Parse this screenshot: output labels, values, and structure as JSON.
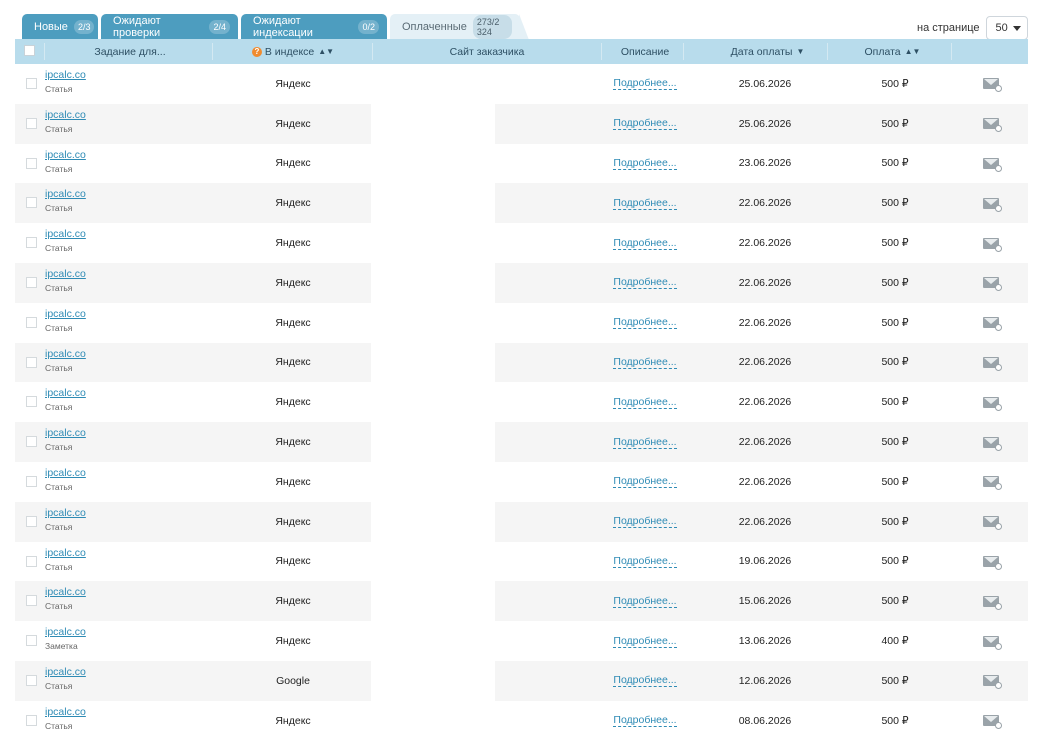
{
  "tabs": [
    {
      "label": "Новые",
      "badge": "2/3"
    },
    {
      "label": "Ожидают проверки",
      "badge": "2/4"
    },
    {
      "label": "Ожидают индексации",
      "badge": "0/2"
    },
    {
      "label": "Оплаченные",
      "badge": "273/2 324"
    }
  ],
  "per_page": {
    "label": "на странице",
    "value": "50"
  },
  "columns": {
    "task": "Задание для...",
    "index": "В индексе",
    "site": "Сайт заказчика",
    "description": "Описание",
    "date": "Дата оплаты",
    "payment": "Оплата"
  },
  "rows": [
    {
      "site": "ipcalc.co",
      "type": "Статья",
      "index": "Яндекс",
      "desc": "Подробнее...",
      "date": "25.06.2026",
      "pay": "500 ₽"
    },
    {
      "site": "ipcalc.co",
      "type": "Статья",
      "index": "Яндекс",
      "desc": "Подробнее...",
      "date": "25.06.2026",
      "pay": "500 ₽"
    },
    {
      "site": "ipcalc.co",
      "type": "Статья",
      "index": "Яндекс",
      "desc": "Подробнее...",
      "date": "23.06.2026",
      "pay": "500 ₽"
    },
    {
      "site": "ipcalc.co",
      "type": "Статья",
      "index": "Яндекс",
      "desc": "Подробнее...",
      "date": "22.06.2026",
      "pay": "500 ₽"
    },
    {
      "site": "ipcalc.co",
      "type": "Статья",
      "index": "Яндекс",
      "desc": "Подробнее...",
      "date": "22.06.2026",
      "pay": "500 ₽"
    },
    {
      "site": "ipcalc.co",
      "type": "Статья",
      "index": "Яндекс",
      "desc": "Подробнее...",
      "date": "22.06.2026",
      "pay": "500 ₽"
    },
    {
      "site": "ipcalc.co",
      "type": "Статья",
      "index": "Яндекс",
      "desc": "Подробнее...",
      "date": "22.06.2026",
      "pay": "500 ₽"
    },
    {
      "site": "ipcalc.co",
      "type": "Статья",
      "index": "Яндекс",
      "desc": "Подробнее...",
      "date": "22.06.2026",
      "pay": "500 ₽"
    },
    {
      "site": "ipcalc.co",
      "type": "Статья",
      "index": "Яндекс",
      "desc": "Подробнее...",
      "date": "22.06.2026",
      "pay": "500 ₽"
    },
    {
      "site": "ipcalc.co",
      "type": "Статья",
      "index": "Яндекс",
      "desc": "Подробнее...",
      "date": "22.06.2026",
      "pay": "500 ₽"
    },
    {
      "site": "ipcalc.co",
      "type": "Статья",
      "index": "Яндекс",
      "desc": "Подробнее...",
      "date": "22.06.2026",
      "pay": "500 ₽"
    },
    {
      "site": "ipcalc.co",
      "type": "Статья",
      "index": "Яндекс",
      "desc": "Подробнее...",
      "date": "22.06.2026",
      "pay": "500 ₽"
    },
    {
      "site": "ipcalc.co",
      "type": "Статья",
      "index": "Яндекс",
      "desc": "Подробнее...",
      "date": "19.06.2026",
      "pay": "500 ₽"
    },
    {
      "site": "ipcalc.co",
      "type": "Статья",
      "index": "Яндекс",
      "desc": "Подробнее...",
      "date": "15.06.2026",
      "pay": "500 ₽"
    },
    {
      "site": "ipcalc.co",
      "type": "Заметка",
      "index": "Яндекс",
      "desc": "Подробнее...",
      "date": "13.06.2026",
      "pay": "400 ₽"
    },
    {
      "site": "ipcalc.co",
      "type": "Статья",
      "index": "Google",
      "desc": "Подробнее...",
      "date": "12.06.2026",
      "pay": "500 ₽"
    },
    {
      "site": "ipcalc.co",
      "type": "Статья",
      "index": "Яндекс",
      "desc": "Подробнее...",
      "date": "08.06.2026",
      "pay": "500 ₽"
    }
  ]
}
